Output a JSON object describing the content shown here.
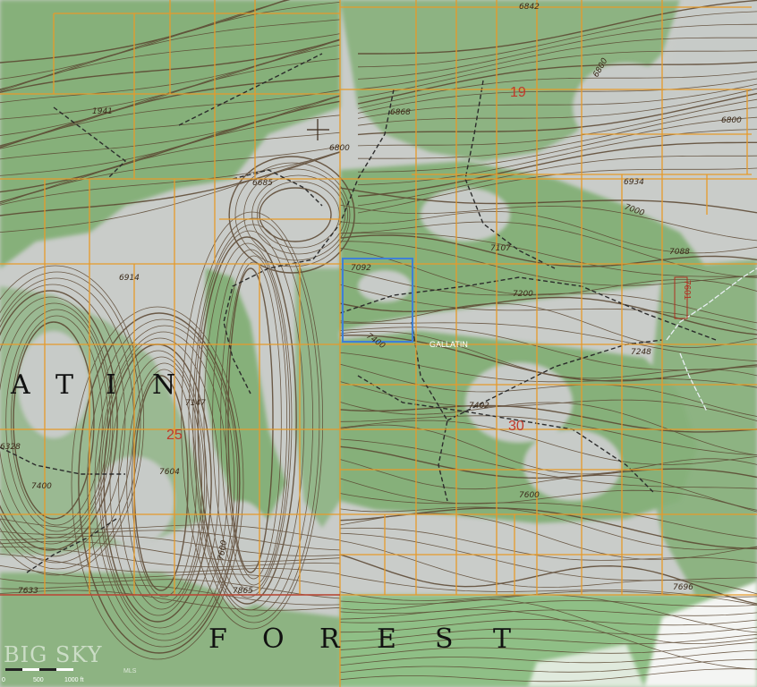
{
  "colors": {
    "base": "#c9ccc9",
    "forest": "#86b07a",
    "forest_dark": "#6f9d66",
    "contour": "#5a4530",
    "grid": "#e69a2a",
    "road": "#2b2b2b",
    "selection": "#3f7fd6",
    "meadow_white": "#f4f5f3"
  },
  "elevations": [
    "6842",
    "6800",
    "6800",
    "6934",
    "7000",
    "7107",
    "7088",
    "7200",
    "7248",
    "7402",
    "7600",
    "7092",
    "7400",
    "6868",
    "6800",
    "6914",
    "7147",
    "7604",
    "7400",
    "7600",
    "7633",
    "7865",
    "7696",
    "1941",
    "6685",
    "6328"
  ],
  "sections": [
    "19",
    "25",
    "30"
  ],
  "place_labels": {
    "gallatin": "GALLATIN"
  },
  "route_marker": "7601",
  "area_name_line1": [
    "A",
    "T",
    "I",
    "N"
  ],
  "area_name_line2": [
    "F",
    "O",
    "R",
    "E",
    "S",
    "T"
  ],
  "watermark": {
    "brand": "BIG SKY",
    "suffix": "MLS"
  },
  "scale_bar": {
    "labels": [
      "0",
      "500",
      "1000 ft"
    ]
  }
}
